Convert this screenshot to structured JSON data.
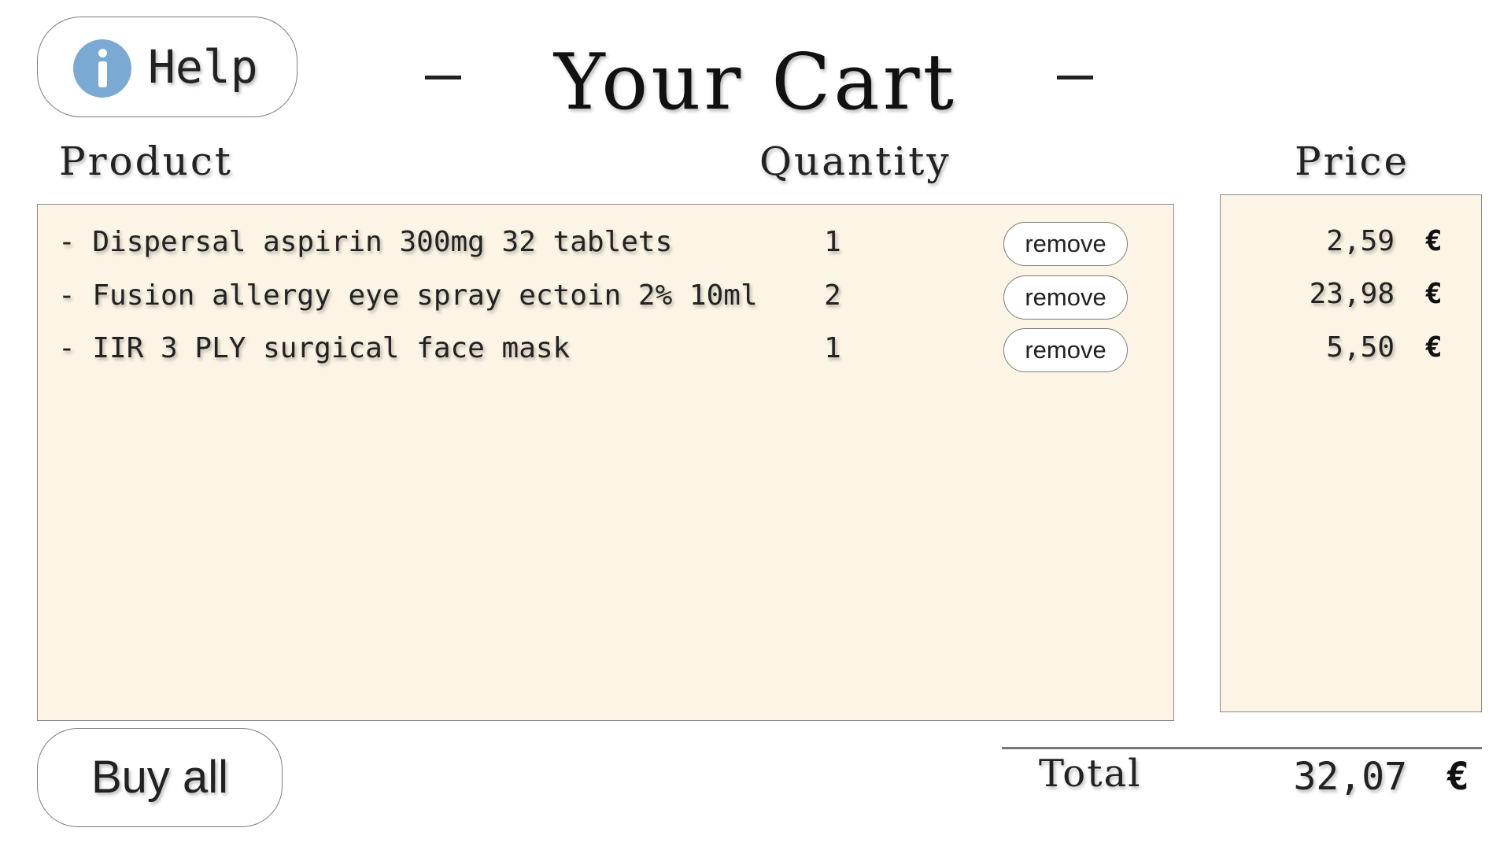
{
  "header": {
    "help_label": "Help",
    "help_icon": "info-icon",
    "title": "Your Cart",
    "title_decoration": "—"
  },
  "columns": {
    "product": "Product",
    "quantity": "Quantity",
    "price": "Price"
  },
  "cart": {
    "items": [
      {
        "name": "- Dispersal aspirin 300mg 32 tablets",
        "quantity": "1",
        "remove_label": "remove",
        "price": "2,59",
        "currency": "€"
      },
      {
        "name": "- Fusion allergy eye spray ectoin 2% 10ml",
        "quantity": "2",
        "remove_label": "remove",
        "price": "23,98",
        "currency": "€"
      },
      {
        "name": "- IIR 3 PLY surgical face mask",
        "quantity": "1",
        "remove_label": "remove",
        "price": "5,50",
        "currency": "€"
      }
    ]
  },
  "footer": {
    "buy_all_label": "Buy all",
    "total_label": "Total",
    "total_value": "32,07",
    "total_currency": "€"
  },
  "colors": {
    "panel_background": "#fcf5e5",
    "info_icon": "#7aaad3",
    "border": "#8a8a8a"
  }
}
